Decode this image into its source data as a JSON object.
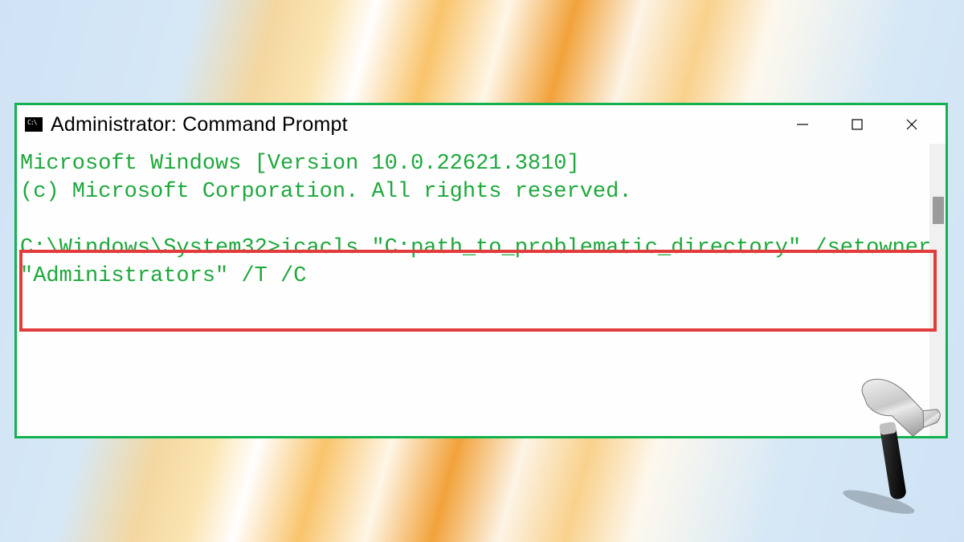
{
  "window": {
    "title": "Administrator: Command Prompt"
  },
  "terminal": {
    "line1": "Microsoft Windows [Version 10.0.22621.3810]",
    "line2": "(c) Microsoft Corporation. All rights reserved.",
    "blank": "",
    "prompt": "C:\\Windows\\System32>",
    "command": "icacls \"C:path_to_problematic_directory\" /setowner \"Administrators\" /T /C"
  },
  "colors": {
    "terminalText": "#1ea83d",
    "outerHighlight": "#11b24f",
    "commandHighlight": "#e13b3b"
  }
}
